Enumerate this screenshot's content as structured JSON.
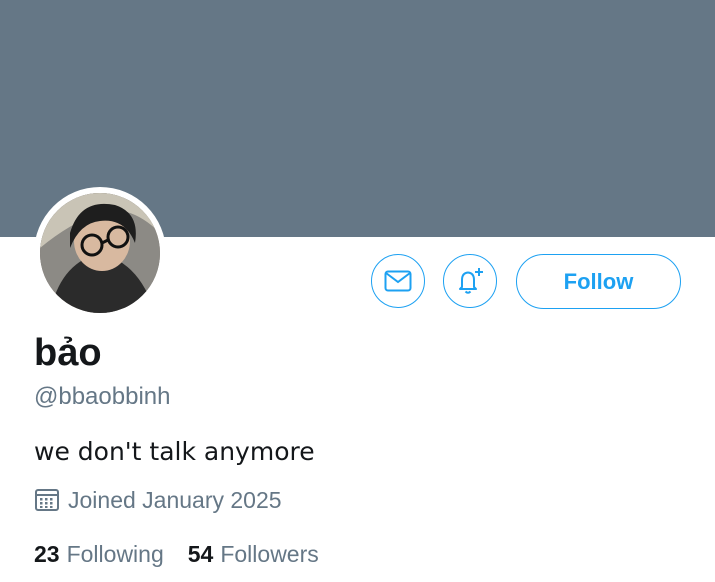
{
  "profile": {
    "name": "bảo",
    "handle": "@bbaobbinh",
    "bio": "we don't talk anymore",
    "joined": "Joined January 2025",
    "following_count": "23",
    "following_label": "Following",
    "followers_count": "54",
    "followers_label": "Followers"
  },
  "actions": {
    "message_icon": "envelope-icon",
    "notify_icon": "bell-plus-icon",
    "follow_label": "Follow"
  },
  "colors": {
    "banner": "#657786",
    "accent": "#1da1f2",
    "secondary_text": "#657786"
  }
}
